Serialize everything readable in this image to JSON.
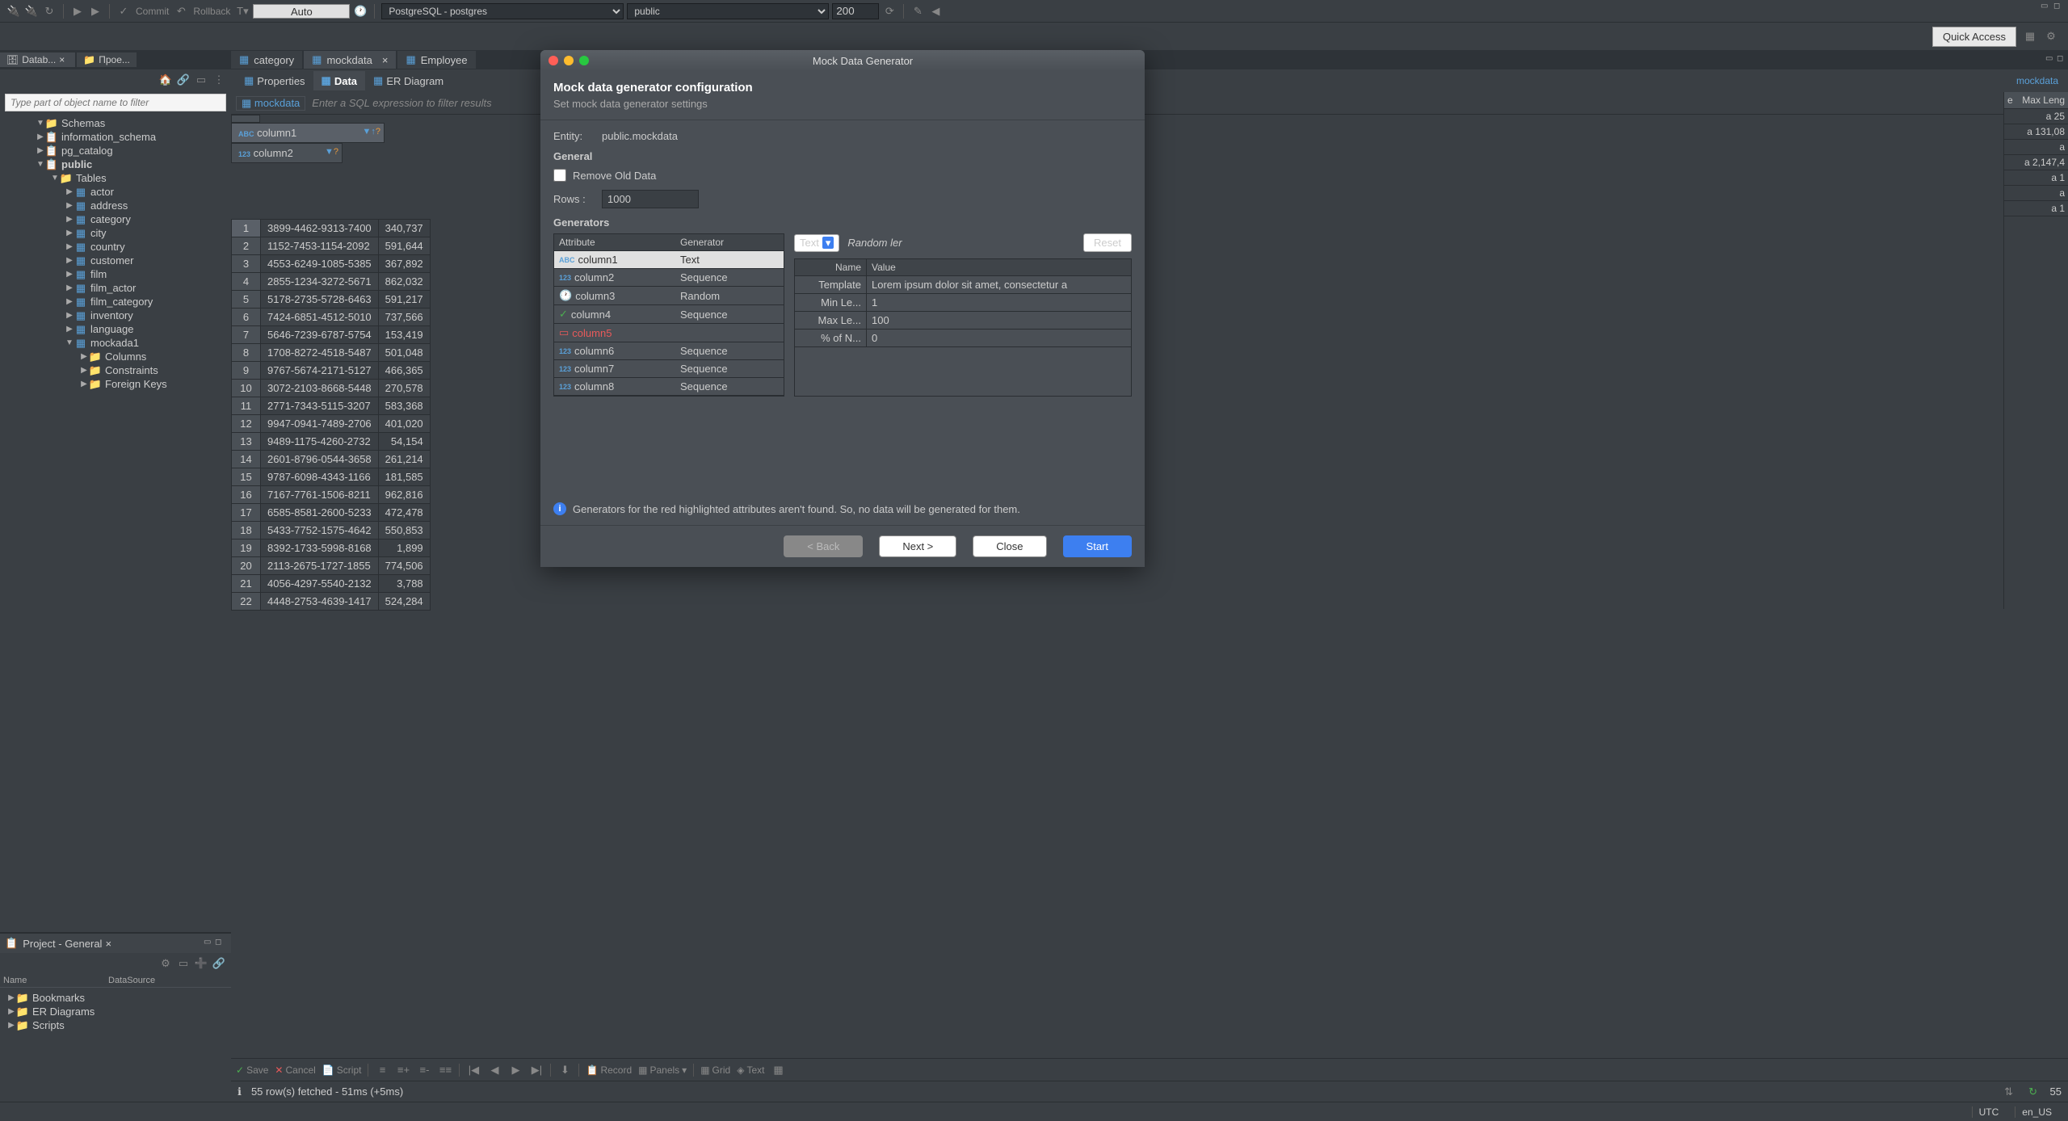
{
  "toolbar": {
    "commit": "Commit",
    "rollback": "Rollback",
    "auto": "Auto",
    "datasource": "PostgreSQL - postgres",
    "schema": "public",
    "rows_limit": "200",
    "quick_access": "Quick Access"
  },
  "left_tabs": {
    "database": "Datab...",
    "projects": "Прое..."
  },
  "filter_placeholder": "Type part of object name to filter",
  "tree": {
    "schemas": "Schemas",
    "items": [
      {
        "label": "information_schema",
        "indent": 2,
        "arrow": "▶",
        "ic": "schema"
      },
      {
        "label": "pg_catalog",
        "indent": 2,
        "arrow": "▶",
        "ic": "schema"
      },
      {
        "label": "public",
        "indent": 2,
        "arrow": "▼",
        "ic": "schema",
        "bold": true
      },
      {
        "label": "Tables",
        "indent": 3,
        "arrow": "▼",
        "ic": "folder"
      },
      {
        "label": "actor",
        "indent": 4,
        "arrow": "▶",
        "ic": "table"
      },
      {
        "label": "address",
        "indent": 4,
        "arrow": "▶",
        "ic": "table"
      },
      {
        "label": "category",
        "indent": 4,
        "arrow": "▶",
        "ic": "table"
      },
      {
        "label": "city",
        "indent": 4,
        "arrow": "▶",
        "ic": "table"
      },
      {
        "label": "country",
        "indent": 4,
        "arrow": "▶",
        "ic": "table"
      },
      {
        "label": "customer",
        "indent": 4,
        "arrow": "▶",
        "ic": "table"
      },
      {
        "label": "film",
        "indent": 4,
        "arrow": "▶",
        "ic": "table"
      },
      {
        "label": "film_actor",
        "indent": 4,
        "arrow": "▶",
        "ic": "table"
      },
      {
        "label": "film_category",
        "indent": 4,
        "arrow": "▶",
        "ic": "table"
      },
      {
        "label": "inventory",
        "indent": 4,
        "arrow": "▶",
        "ic": "table"
      },
      {
        "label": "language",
        "indent": 4,
        "arrow": "▶",
        "ic": "table"
      },
      {
        "label": "mockada1",
        "indent": 4,
        "arrow": "▼",
        "ic": "table"
      },
      {
        "label": "Columns",
        "indent": 5,
        "arrow": "▶",
        "ic": "folder"
      },
      {
        "label": "Constraints",
        "indent": 5,
        "arrow": "▶",
        "ic": "folder"
      },
      {
        "label": "Foreign Keys",
        "indent": 5,
        "arrow": "▶",
        "ic": "folder"
      }
    ]
  },
  "project": {
    "title": "Project - General",
    "col_name": "Name",
    "col_ds": "DataSource",
    "items": [
      "Bookmarks",
      "ER Diagrams",
      "Scripts"
    ]
  },
  "editor": {
    "tabs": [
      {
        "label": "category",
        "active": false
      },
      {
        "label": "mockdata",
        "active": true
      },
      {
        "label": "Employee",
        "active": false
      }
    ],
    "subtabs": [
      {
        "label": "Properties",
        "active": false
      },
      {
        "label": "Data",
        "active": true
      },
      {
        "label": "ER Diagram",
        "active": false
      }
    ],
    "breadcrumb": "mockdata",
    "sql_hint": "Enter a SQL expression to filter results",
    "columns": [
      "column1",
      "column2"
    ],
    "rows": [
      {
        "n": "1",
        "c1": "3899-4462-9313-7400",
        "c2": "340,737"
      },
      {
        "n": "2",
        "c1": "1152-7453-1154-2092",
        "c2": "591,644"
      },
      {
        "n": "3",
        "c1": "4553-6249-1085-5385",
        "c2": "367,892"
      },
      {
        "n": "4",
        "c1": "2855-1234-3272-5671",
        "c2": "862,032"
      },
      {
        "n": "5",
        "c1": "5178-2735-5728-6463",
        "c2": "591,217"
      },
      {
        "n": "6",
        "c1": "7424-6851-4512-5010",
        "c2": "737,566"
      },
      {
        "n": "7",
        "c1": "5646-7239-6787-5754",
        "c2": "153,419"
      },
      {
        "n": "8",
        "c1": "1708-8272-4518-5487",
        "c2": "501,048"
      },
      {
        "n": "9",
        "c1": "9767-5674-2171-5127",
        "c2": "466,365"
      },
      {
        "n": "10",
        "c1": "3072-2103-8668-5448",
        "c2": "270,578"
      },
      {
        "n": "11",
        "c1": "2771-7343-5115-3207",
        "c2": "583,368"
      },
      {
        "n": "12",
        "c1": "9947-0941-7489-2706",
        "c2": "401,020"
      },
      {
        "n": "13",
        "c1": "9489-1175-4260-2732",
        "c2": "54,154"
      },
      {
        "n": "14",
        "c1": "2601-8796-0544-3658",
        "c2": "261,214"
      },
      {
        "n": "15",
        "c1": "9787-6098-4343-1166",
        "c2": "181,585"
      },
      {
        "n": "16",
        "c1": "7167-7761-1506-8211",
        "c2": "962,816"
      },
      {
        "n": "17",
        "c1": "6585-8581-2600-5233",
        "c2": "472,478"
      },
      {
        "n": "18",
        "c1": "5433-7752-1575-4642",
        "c2": "550,853"
      },
      {
        "n": "19",
        "c1": "8392-1733-5998-8168",
        "c2": "1,899"
      },
      {
        "n": "20",
        "c1": "2113-2675-1727-1855",
        "c2": "774,506"
      },
      {
        "n": "21",
        "c1": "4056-4297-5540-2132",
        "c2": "3,788"
      },
      {
        "n": "22",
        "c1": "4448-2753-4639-1417",
        "c2": "524,284"
      }
    ],
    "bottom": {
      "save": "Save",
      "cancel": "Cancel",
      "script": "Script",
      "record": "Record",
      "panels": "Panels",
      "grid": "Grid",
      "text": "Text"
    },
    "status": "55 row(s) fetched - 51ms (+5ms)",
    "status_rows": "55"
  },
  "right_panel": {
    "hdr1": "e",
    "hdr2": "Max Leng",
    "vals": [
      "a   25",
      "a   131,08",
      "a",
      "a   2,147,4",
      "a   1",
      "a",
      "a   1"
    ]
  },
  "dialog": {
    "title": "Mock Data Generator",
    "heading": "Mock data generator configuration",
    "subheading": "Set mock data generator settings",
    "entity_lbl": "Entity:",
    "entity_val": "public.mockdata",
    "general": "General",
    "remove_old": "Remove Old Data",
    "rows_lbl": "Rows :",
    "rows_val": "1000",
    "generators": "Generators",
    "attr_hdr": "Attribute",
    "gen_hdr": "Generator",
    "attrs": [
      {
        "name": "column1",
        "gen": "Text",
        "ic": "abc",
        "sel": true
      },
      {
        "name": "column2",
        "gen": "Sequence",
        "ic": "123"
      },
      {
        "name": "column3",
        "gen": "Random",
        "ic": "clock"
      },
      {
        "name": "column4",
        "gen": "Sequence",
        "ic": "check"
      },
      {
        "name": "column5",
        "gen": "",
        "ic": "sq",
        "err": true
      },
      {
        "name": "column6",
        "gen": "Sequence",
        "ic": "123"
      },
      {
        "name": "column7",
        "gen": "Sequence",
        "ic": "123"
      },
      {
        "name": "column8",
        "gen": "Sequence",
        "ic": "123"
      }
    ],
    "gen_type": "Text",
    "gen_desc": "Random ler",
    "reset": "Reset",
    "name_hdr": "Name",
    "value_hdr": "Value",
    "props": [
      {
        "name": "Template",
        "value": "Lorem ipsum dolor sit amet, consectetur a"
      },
      {
        "name": "Min Le...",
        "value": "1"
      },
      {
        "name": "Max Le...",
        "value": "100"
      },
      {
        "name": "% of N...",
        "value": "0"
      }
    ],
    "info": "Generators for the red highlighted attributes aren't found. So, no data will be generated for them.",
    "back": "< Back",
    "next": "Next >",
    "close": "Close",
    "start": "Start"
  },
  "statusbar": {
    "tz": "UTC",
    "locale": "en_US"
  }
}
